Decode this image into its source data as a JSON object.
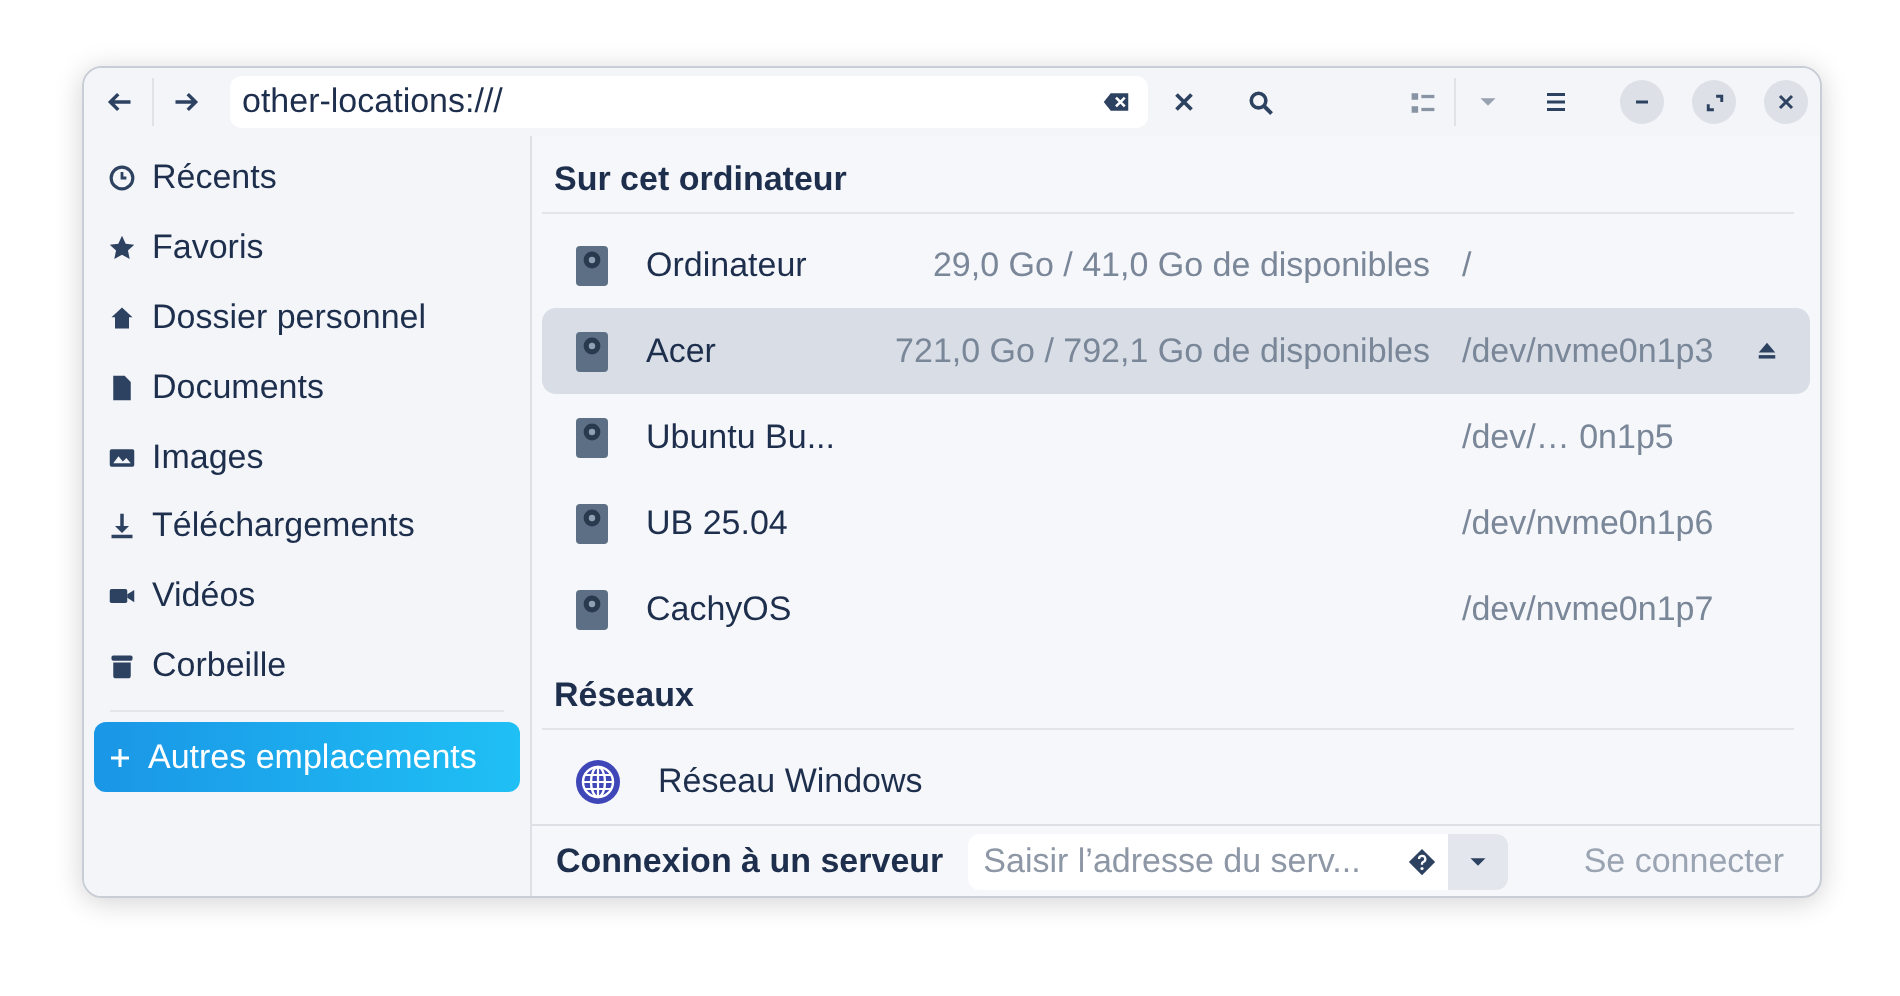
{
  "toolbar": {
    "location": "other-locations:///"
  },
  "sidebar": {
    "items": [
      {
        "label": "Récents",
        "selected": false
      },
      {
        "label": "Favoris",
        "selected": false
      },
      {
        "label": "Dossier personnel",
        "selected": false
      },
      {
        "label": "Documents",
        "selected": false
      },
      {
        "label": "Images",
        "selected": false
      },
      {
        "label": "Téléchargements",
        "selected": false
      },
      {
        "label": "Vidéos",
        "selected": false
      },
      {
        "label": "Corbeille",
        "selected": false
      }
    ],
    "other": {
      "label": "Autres emplacements",
      "selected": true
    }
  },
  "sections": [
    {
      "title": "Sur cet ordinateur",
      "rows": [
        {
          "kind": "drive",
          "name": "Ordinateur",
          "size": "29,0 Go / 41,0 Go de disponibles",
          "path": "/",
          "selected": false,
          "ejectable": false
        },
        {
          "kind": "drive",
          "name": "Acer",
          "size": "721,0 Go / 792,1 Go de disponibles",
          "path": "/dev/nvme0n1p3",
          "selected": true,
          "ejectable": true
        },
        {
          "kind": "drive",
          "name": "Ubuntu Bu...",
          "path": "/dev/… 0n1p5",
          "selected": false,
          "ejectable": false
        },
        {
          "kind": "drive",
          "name": "UB 25.04",
          "path": "/dev/nvme0n1p6",
          "selected": false,
          "ejectable": false
        },
        {
          "kind": "drive",
          "name": "CachyOS",
          "path": "/dev/nvme0n1p7",
          "selected": false,
          "ejectable": false
        }
      ]
    },
    {
      "title": "Réseaux",
      "rows": [
        {
          "kind": "network",
          "name": "Réseau Windows",
          "selected": false,
          "ejectable": false
        }
      ]
    }
  ],
  "server_bar": {
    "label": "Connexion à un serveur",
    "placeholder": "Saisir l’adresse du serv...",
    "connect": {
      "label": "Se connecter",
      "disabled": true
    }
  }
}
